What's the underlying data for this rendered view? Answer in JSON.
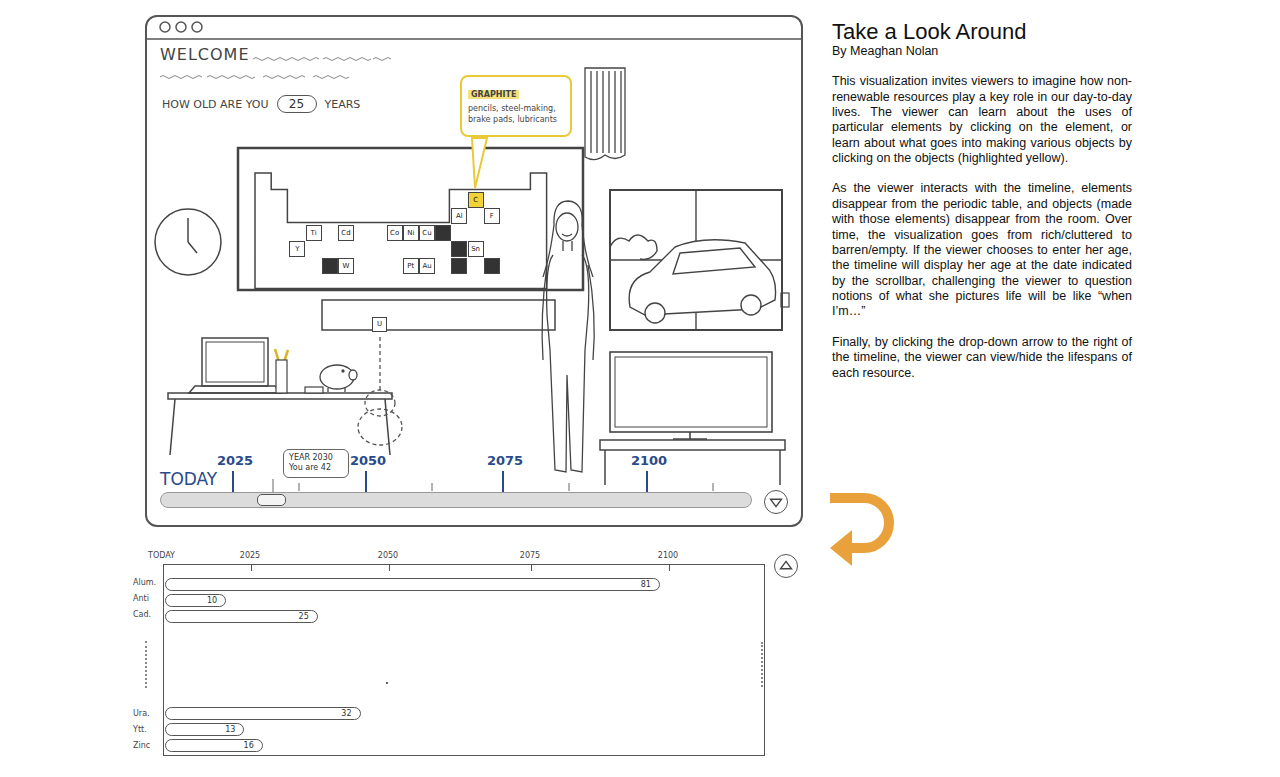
{
  "window": {
    "welcome": "WELCOME",
    "age_prompt": "HOW OLD ARE YOU",
    "age": "25",
    "age_unit": "YEARS"
  },
  "tooltip": {
    "title": "GRAPHITE",
    "body": "pencils, steel-making, brake pads, lubricants"
  },
  "periodic_table": {
    "elements": [
      {
        "symbol": "C",
        "selected": true,
        "depleted": false
      },
      {
        "symbol": "Al",
        "selected": false,
        "depleted": false
      },
      {
        "symbol": "F",
        "selected": false,
        "depleted": false
      },
      {
        "symbol": "Ti",
        "selected": false,
        "depleted": false
      },
      {
        "symbol": "Cd",
        "selected": false,
        "depleted": false
      },
      {
        "symbol": "Co",
        "selected": false,
        "depleted": false
      },
      {
        "symbol": "Ni",
        "selected": false,
        "depleted": false
      },
      {
        "symbol": "Cu",
        "selected": false,
        "depleted": false
      },
      {
        "symbol": "Y",
        "selected": false,
        "depleted": false
      },
      {
        "symbol": "Sn",
        "selected": false,
        "depleted": false
      },
      {
        "symbol": "W",
        "selected": false,
        "depleted": false
      },
      {
        "symbol": "Pt",
        "selected": false,
        "depleted": false
      },
      {
        "symbol": "Au",
        "selected": false,
        "depleted": false
      },
      {
        "symbol": "",
        "selected": false,
        "depleted": true
      },
      {
        "symbol": "",
        "selected": false,
        "depleted": true
      },
      {
        "symbol": "",
        "selected": false,
        "depleted": true
      },
      {
        "symbol": "",
        "selected": false,
        "depleted": true
      },
      {
        "symbol": "",
        "selected": false,
        "depleted": true
      }
    ],
    "f_block": [
      {
        "symbol": "U",
        "selected": false,
        "depleted": false
      }
    ]
  },
  "timeline": {
    "start": "TODAY",
    "ticks": [
      "2025",
      "2050",
      "2075",
      "2100"
    ],
    "tooltip": {
      "year": "YEAR 2030",
      "age": "You are 42"
    },
    "level": 0.17,
    "expanded": false
  },
  "lifespans": {
    "start": "TODAY",
    "ticks": [
      "2025",
      "2050",
      "2075",
      "2100"
    ],
    "expanded": true,
    "resources": [
      {
        "name": "Alum.",
        "years": 81,
        "label": "81"
      },
      {
        "name": "Anti",
        "years": 10,
        "label": "10"
      },
      {
        "name": "Cad.",
        "years": 25,
        "label": "25"
      },
      {
        "name": "Ura.",
        "years": 32,
        "label": "32"
      },
      {
        "name": "Ytt.",
        "years": 13,
        "label": "13"
      },
      {
        "name": "Zinc",
        "years": 16,
        "label": "16"
      }
    ]
  },
  "article": {
    "title": "Take a Look Around",
    "author": "By Meaghan Nolan",
    "paragraphs": [
      "This visualization invites viewers to imagine how non-renewable resources play a key role in our day-to-day lives. The viewer can learn about the uses of particular elements by clicking on the element, or learn about what goes into making various objects by clicking on the objects (highlighted yellow).",
      "As the viewer interacts with the timeline, elements disappear from the periodic table, and objects (made with those elements) disappear from the room. Over time, the visualization goes from rich/cluttered to barren/empty. If the viewer chooses to enter her age, the timeline will display her age at the date indicated by the scrollbar, challenging the viewer to question notions of what she pictures life will be like “when I’m…”",
      "Finally, by clicking the drop-down arrow to the right of the timeline, the viewer can view/hide the lifespans of each resource."
    ]
  }
}
